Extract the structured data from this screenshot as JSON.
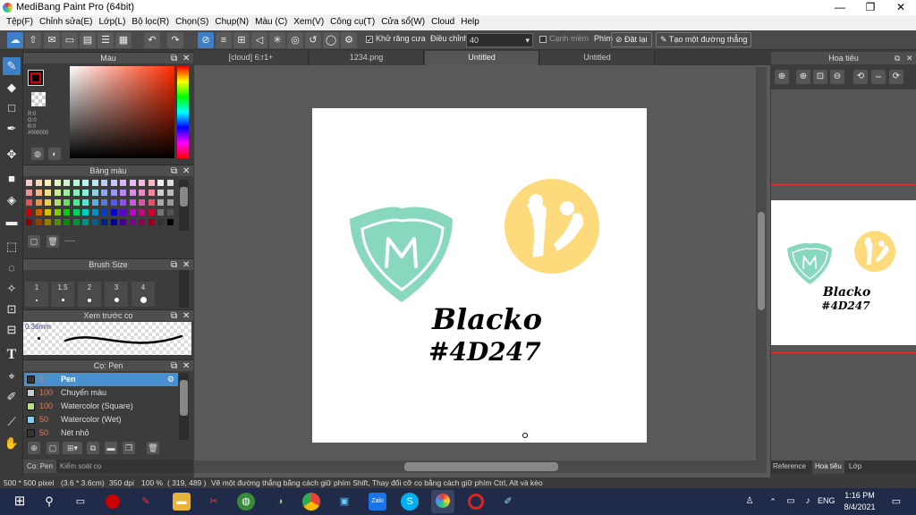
{
  "window": {
    "title": "MediBang Paint Pro (64bit)",
    "minimize": "—",
    "maximize": "❐",
    "close": "✕"
  },
  "menu": [
    "Tệp(F)",
    "Chỉnh sửa(E)",
    "Lớp(L)",
    "Bộ lọc(R)",
    "Chọn(S)",
    "Chụp(N)",
    "Màu (C)",
    "Xem(V)",
    "Công cụ(T)",
    "Cửa sổ(W)",
    "Cloud",
    "Help"
  ],
  "toolbar": {
    "antialias_label": "Khử răng cưa",
    "adjust_label": "Điều chỉnh",
    "adjust_value": "40",
    "soft_edge_label": "Cạnh mềm",
    "key_label": "Phím",
    "reset_label": "Đặt lại",
    "create_line_label": "Tạo một đường thẳng"
  },
  "color_panel": {
    "title": "Màu",
    "r": "R:0",
    "g": "G:0",
    "b": "B:0",
    "hex": "#000000"
  },
  "palette_panel": {
    "title": "Bảng màu",
    "name_placeholder": "----"
  },
  "brush_size_panel": {
    "title": "Brush Size",
    "sizes": [
      "1",
      "1.5",
      "2",
      "3",
      "4"
    ]
  },
  "preview_panel": {
    "title": "Xem trước cọ",
    "size": "0.36mm"
  },
  "brush_panel": {
    "title": "Cọ: Pen",
    "items": [
      {
        "size": "5",
        "name": "Pen",
        "color": "#333333",
        "selected": true
      },
      {
        "size": "100",
        "name": "Chuyển màu",
        "color": "#cccccc",
        "selected": false
      },
      {
        "size": "100",
        "name": "Watercolor (Square)",
        "color": "#b8e26a",
        "selected": false
      },
      {
        "size": "50",
        "name": "Watercolor (Wet)",
        "color": "#7cd0f0",
        "selected": false
      },
      {
        "size": "50",
        "name": "Nét nhỏ",
        "color": "#333333",
        "selected": false
      }
    ],
    "tab_active": "Cọ: Pen",
    "tab_other": "Kiểm soát cọ"
  },
  "canvas_tabs": [
    "[cloud] 6:r1+",
    "1234.png",
    "Untitled",
    "Untitled"
  ],
  "canvas": {
    "handwriting_line1": "Blacko",
    "handwriting_line2": "#4D247",
    "shield_color": "#88d8c0",
    "circle_color": "#fddb7c",
    "shield_letter": "M"
  },
  "navigator_panel": {
    "title": "Hoa tiêu",
    "tabs": [
      "Reference",
      "Hoa tiêu",
      "Lớp"
    ]
  },
  "status": {
    "size": "500 * 500 pixel",
    "cm": "(3.6 * 3.6cm)",
    "dpi": "350 dpi",
    "zoom": "100 %",
    "coords": "( 319, 489 )",
    "hint": "Vẽ một đường thẳng bằng cách giữ phím Shift, Thay đổi cỡ cọ bằng cách giữ phím Ctrl, Alt và kéo"
  },
  "taskbar": {
    "lang": "ENG",
    "time": "1:16 PM",
    "date": "8/4/2021"
  }
}
